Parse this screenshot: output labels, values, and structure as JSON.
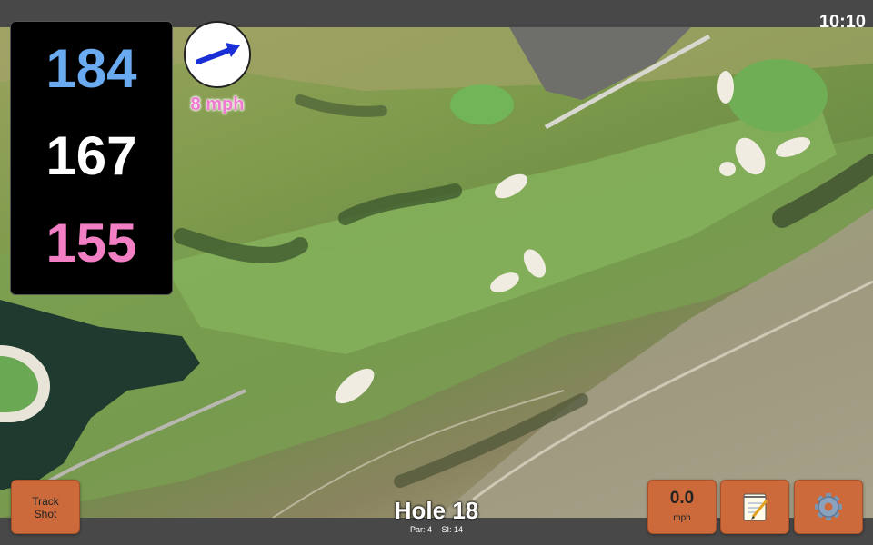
{
  "status": {
    "time": "10:10"
  },
  "yardages": {
    "back": "184",
    "center": "167",
    "front": "155"
  },
  "wind": {
    "speed_label": "8 mph",
    "direction": "arrow-pointing-east-north-east"
  },
  "buttons": {
    "track_shot": {
      "line1": "Track",
      "line2": "Shot"
    },
    "wind_readout": {
      "value": "0.0",
      "unit": "mph"
    },
    "notes_icon": "notepad-icon",
    "settings_icon": "gear-icon"
  },
  "hole": {
    "title": "Hole 18",
    "par": "Par: 4",
    "stroke_index": "SI: 14"
  },
  "colors": {
    "back_yardage": "#6aaaf0",
    "center_yardage": "#ffffff",
    "front_yardage": "#f27fc4",
    "button_fill": "#cc6a3c",
    "wind_label": "#f07ad0"
  }
}
